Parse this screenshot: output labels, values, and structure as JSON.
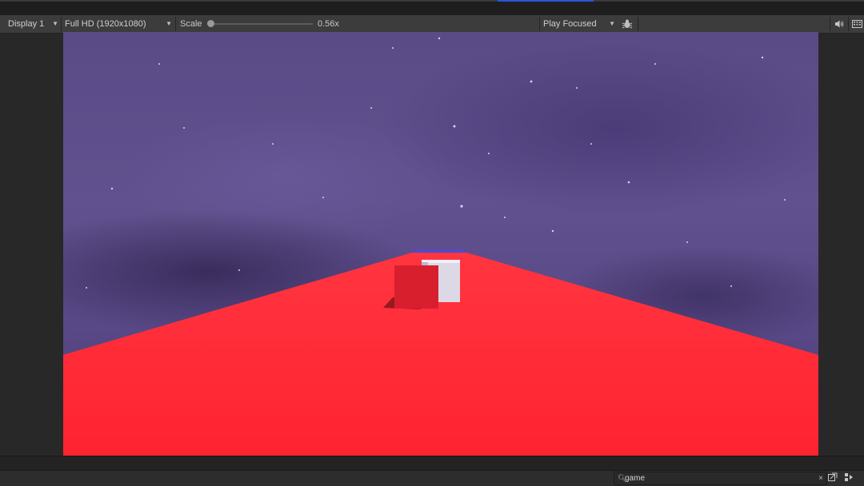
{
  "toolbar": {
    "display": "Display 1",
    "resolution": "Full HD (1920x1080)",
    "scale_label": "Scale",
    "scale_value": "0.56x",
    "scale_fraction": 0.0,
    "play_mode": "Play Focused",
    "icons": {
      "bug": "bug-icon",
      "audio": "speaker-icon",
      "keyboard": "keyboard-icon"
    }
  },
  "game_view": {
    "sky_color": "#5a4a86",
    "road_color": "#ff2330",
    "cube_red_color": "#d81f2d",
    "cube_white_color": "#dcd8e6"
  },
  "search": {
    "value": "game",
    "icon": "search-icon",
    "clear_icon": "clear-icon"
  },
  "bottom_icons": {
    "settings": "window-settings-icon",
    "layers": "layers-icon"
  }
}
